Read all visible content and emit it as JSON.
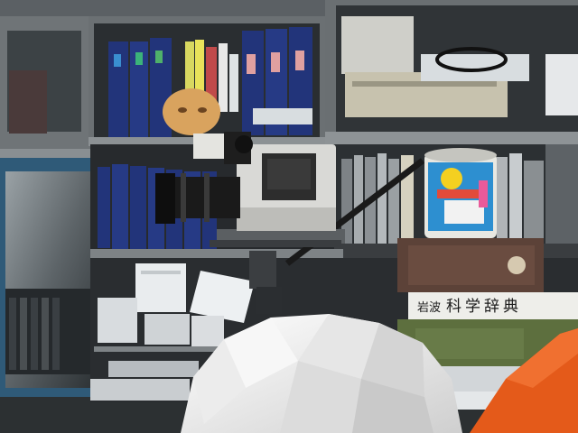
{
  "scene": {
    "description_tags": [
      "office-shelf",
      "video-camera",
      "books",
      "binders",
      "mannequin-head",
      "canister"
    ]
  },
  "books": {
    "dictionary_spine": "科学辞典",
    "dictionary_prefix": "岩波"
  },
  "colors": {
    "shelf_frame": "#7d8285",
    "shelf_dark": "#1f2224",
    "binder_blue": "#22347a",
    "camera_body": "#d9d9d6",
    "camera_dark": "#2d2d2d",
    "canister_blue": "#2d8fd0",
    "orange_object": "#e45a1a",
    "white_shape": "#f0f0f0"
  }
}
